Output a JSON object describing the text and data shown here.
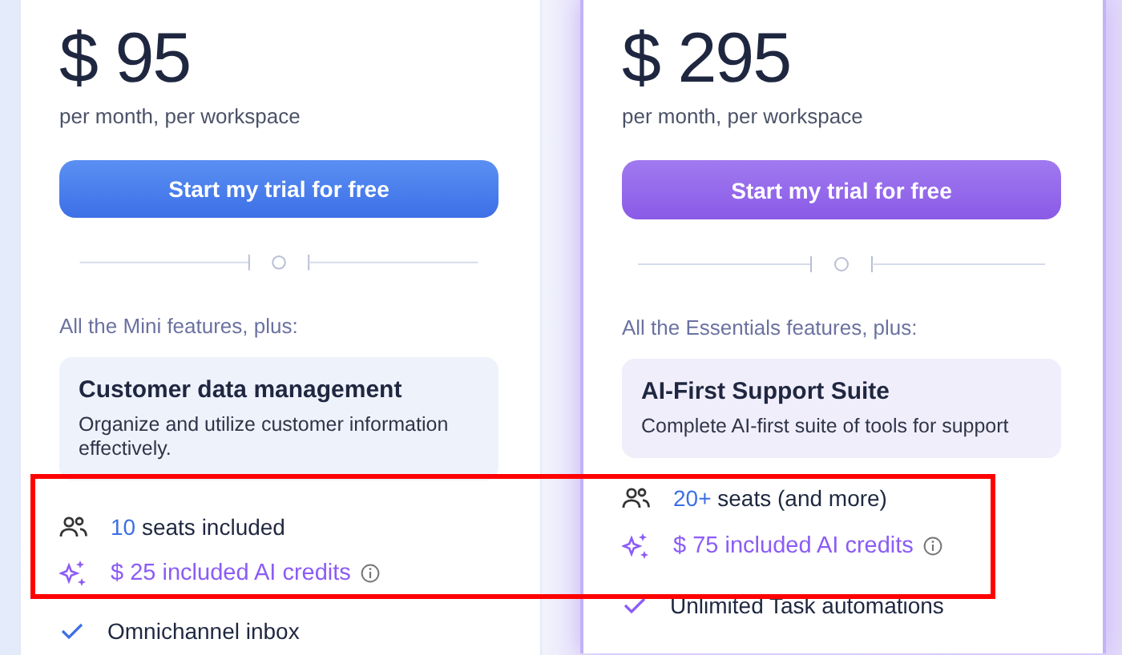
{
  "plans": [
    {
      "kind": "standard",
      "price": "$ 95",
      "period": "per month, per workspace",
      "cta": "Start my trial for free",
      "intro": "All the Mini features, plus:",
      "highlight": {
        "title": "Customer data management",
        "description": "Organize and utilize customer information effectively."
      },
      "seats": {
        "count": "10",
        "text": "seats included"
      },
      "credits": "$ 25 included AI credits",
      "features": [
        "Omnichannel inbox"
      ]
    },
    {
      "kind": "featured",
      "price": "$ 295",
      "period": "per month, per workspace",
      "cta": "Start my trial for free",
      "intro": "All the Essentials features, plus:",
      "highlight": {
        "title": "AI-First Support Suite",
        "description": "Complete AI-first suite of tools for support"
      },
      "seats": {
        "count": "20+",
        "text": "seats (and more)"
      },
      "credits": "$ 75 included AI credits",
      "features": [
        "Unlimited Task automations"
      ]
    }
  ],
  "annotations": [
    {
      "kind": "rectangle"
    }
  ]
}
